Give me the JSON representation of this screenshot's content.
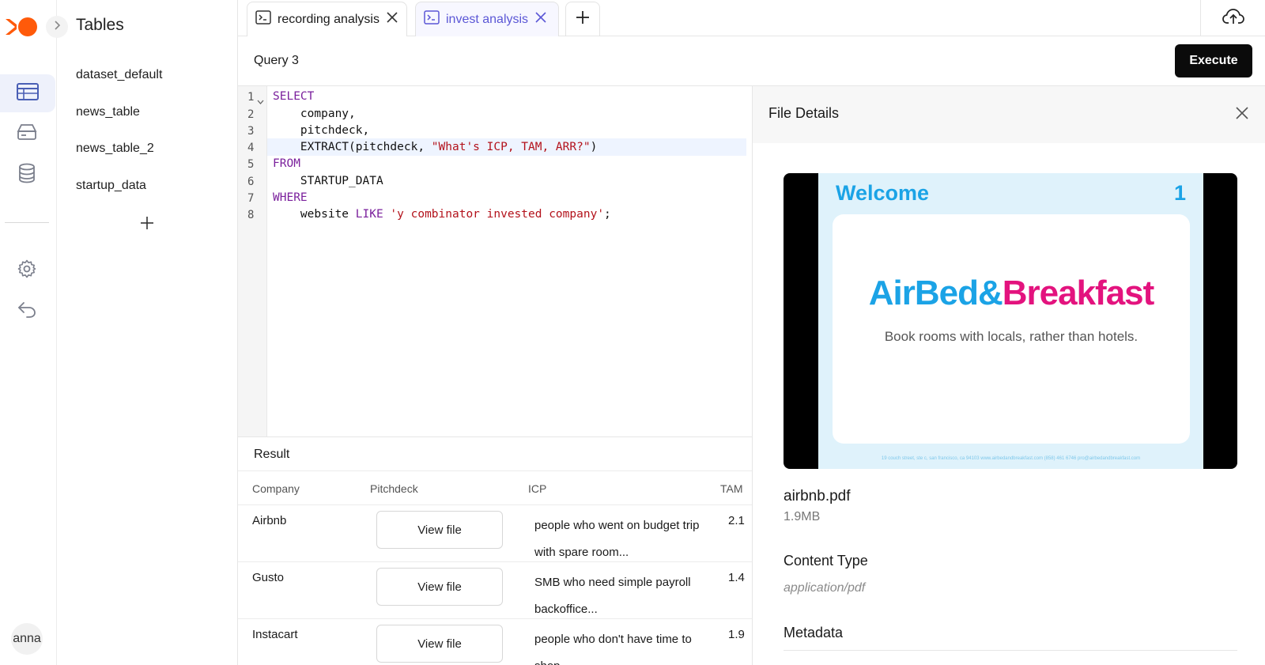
{
  "brand": {
    "accent": "#ff5a0a",
    "primary_button_bg": "#0b0b0b",
    "active_tab_color": "#5b57d6"
  },
  "rail": {
    "icons": [
      "table-icon",
      "storage-icon",
      "database-icon",
      "settings-icon",
      "undo-icon"
    ],
    "user": "anna"
  },
  "tables": {
    "title": "Tables",
    "items": [
      {
        "label": "dataset_default"
      },
      {
        "label": "news_table"
      },
      {
        "label": "news_table_2"
      },
      {
        "label": "startup_data"
      }
    ]
  },
  "tabs": [
    {
      "label": "recording analysis",
      "active": false
    },
    {
      "label": "invest analysis",
      "active": true
    }
  ],
  "query": {
    "title": "Query 3",
    "execute_label": "Execute"
  },
  "editor": {
    "line_numbers": [
      "1",
      "2",
      "3",
      "4",
      "5",
      "6",
      "7",
      "8"
    ],
    "highlighted_line": 4,
    "lines": [
      "SELECT",
      "    company,",
      "    pitchdeck,",
      "    EXTRACT(pitchdeck, \"What's ICP, TAM, ARR?\")",
      "FROM",
      "    STARTUP_DATA",
      "WHERE",
      "    website LIKE 'y combinator invested company';"
    ]
  },
  "result": {
    "title": "Result",
    "columns": [
      "Company",
      "Pitchdeck",
      "ICP",
      "TAM"
    ],
    "rows": [
      {
        "company": "Airbnb",
        "pitchdeck": "View file",
        "icp": "people who went on budget trip with spare room...",
        "tam": "2.1"
      },
      {
        "company": "Gusto",
        "pitchdeck": "View file",
        "icp": "SMB who need simple payroll backoffice...",
        "tam": "1.4"
      },
      {
        "company": "Instacart",
        "pitchdeck": "View file",
        "icp": "people who don't have time to shop...",
        "tam": "1.9"
      }
    ]
  },
  "details": {
    "title": "File Details",
    "preview": {
      "heading": "Welcome",
      "page_number": "1",
      "brand_part1": "AirBed&",
      "brand_part2": "Breakfast",
      "tagline": "Book rooms with locals, rather than hotels.",
      "footer": "19 couch street, ste c, san francisco, ca 94103   www.airbedandbreakfast.com   (858) 461 6746   pro@airbedandbreakfast.com"
    },
    "file_name": "airbnb.pdf",
    "file_size": "1.9MB",
    "content_type_label": "Content Type",
    "content_type_value": "application/pdf",
    "metadata_label": "Metadata"
  }
}
